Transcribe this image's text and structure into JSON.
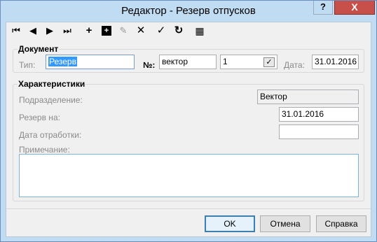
{
  "window": {
    "title": "Редактор - Резерв отпусков",
    "help_label": "?",
    "close_label": "X"
  },
  "toolbar": {
    "first": "⏮",
    "prev": "◀",
    "next": "▶",
    "last": "⏭",
    "add": "+",
    "add_copy": "+",
    "edit": "✎",
    "delete": "✕",
    "apply": "✓",
    "refresh": "↻",
    "table_view": "▦"
  },
  "document": {
    "title": "Документ",
    "type_label": "Тип:",
    "type_value": "Резерв",
    "number_label": "№:",
    "number_value": "вектор",
    "count_value": "1",
    "checkbox_mark": "✓",
    "date_label": "Дата:",
    "date_value": "31.01.2016"
  },
  "characteristics": {
    "title": "Характеристики",
    "division_label": "Подразделение:",
    "division_value": "Вектор",
    "reserve_label": "Резерв на:",
    "reserve_value": "31.01.2016",
    "workoff_label": "Дата отработки:",
    "workoff_value": "",
    "note_label": "Примечание:",
    "note_value": ""
  },
  "buttons": {
    "ok": "OK",
    "cancel": "Отмена",
    "help": "Справка"
  }
}
